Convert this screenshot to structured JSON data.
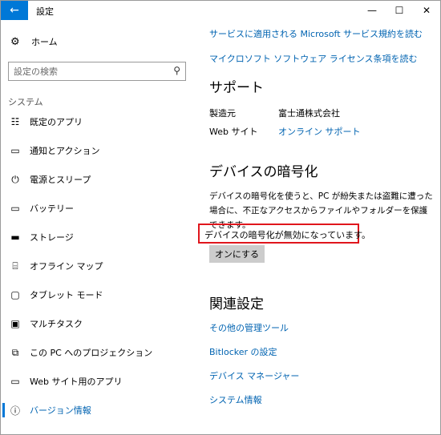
{
  "window": {
    "title": "設定",
    "back_glyph": "←",
    "min_glyph": "—",
    "max_glyph": "☐",
    "close_glyph": "✕"
  },
  "sidebar": {
    "home": {
      "label": "ホーム",
      "icon": "gear-icon",
      "glyph": "⚙"
    },
    "search": {
      "placeholder": "設定の検索",
      "icon": "search-icon",
      "glyph": "⚲"
    },
    "section": "システム",
    "items": [
      {
        "label": "既定のアプリ",
        "icon": "default-apps-icon",
        "glyph": "☷"
      },
      {
        "label": "通知とアクション",
        "icon": "notifications-icon",
        "glyph": "▭"
      },
      {
        "label": "電源とスリープ",
        "icon": "power-icon",
        "glyph": "⏻"
      },
      {
        "label": "バッテリー",
        "icon": "battery-icon",
        "glyph": "▭"
      },
      {
        "label": "ストレージ",
        "icon": "storage-icon",
        "glyph": "▬"
      },
      {
        "label": "オフライン マップ",
        "icon": "offline-maps-icon",
        "glyph": "⌸"
      },
      {
        "label": "タブレット モード",
        "icon": "tablet-mode-icon",
        "glyph": "▢"
      },
      {
        "label": "マルチタスク",
        "icon": "multitasking-icon",
        "glyph": "▣"
      },
      {
        "label": "この PC へのプロジェクション",
        "icon": "projection-icon",
        "glyph": "⧉"
      },
      {
        "label": "Web サイト用のアプリ",
        "icon": "apps-for-websites-icon",
        "glyph": "▭"
      },
      {
        "label": "バージョン情報",
        "icon": "info-icon",
        "glyph": "ⓘ",
        "active": true
      }
    ]
  },
  "main": {
    "links_top": [
      "サービスに適用される Microsoft サービス規約を読む",
      "マイクロソフト ソフトウェア ライセンス条項を読む"
    ],
    "support": {
      "heading": "サポート",
      "manufacturer_key": "製造元",
      "manufacturer_val": "富士通株式会社",
      "website_key": "Web サイト",
      "website_val": "オンライン サポート"
    },
    "encryption": {
      "heading": "デバイスの暗号化",
      "description": "デバイスの暗号化を使うと、PC が紛失または盗難に遭った場合に、不正なアクセスからファイルやフォルダーを保護できます。",
      "status": "デバイスの暗号化が無効になっています。",
      "button": "オンにする",
      "highlight_color": "#e0161d"
    },
    "related": {
      "heading": "関連設定",
      "links": [
        "その他の管理ツール",
        "Bitlocker の設定",
        "デバイス マネージャー",
        "システム情報"
      ]
    }
  },
  "colors": {
    "accent": "#0078d7",
    "link": "#0063b1"
  }
}
